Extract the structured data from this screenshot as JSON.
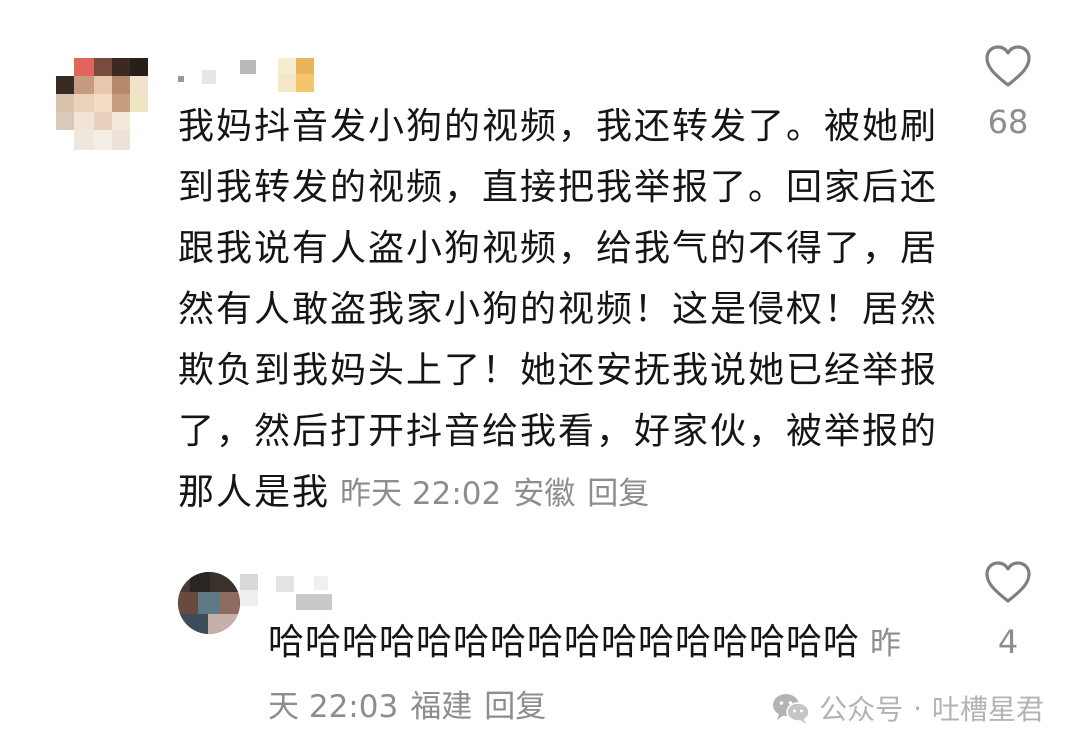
{
  "comments": [
    {
      "text": "我妈抖音发小狗的视频，我还转发了。被她刷到我转发的视频，直接把我举报了。回家后还跟我说有人盗小狗视频，给我气的不得了，居然有人敢盗我家小狗的视频！这是侵权！居然欺负到我妈头上了！她还安抚我说她已经举报了，然后打开抖音给我看，好家伙，被举报的那人是我",
      "time": "昨天 22:02",
      "location": "安徽",
      "reply_label": "回复",
      "likes": "68"
    },
    {
      "text": "哈哈哈哈哈哈哈哈哈哈哈哈哈哈哈哈",
      "time": "昨天 22:03",
      "location": "福建",
      "reply_label": "回复",
      "likes": "4"
    }
  ],
  "watermark": {
    "platform": "公众号",
    "separator": "·",
    "account": "吐槽星君"
  },
  "colors": {
    "text": "#151515",
    "meta": "#8d8d8d",
    "watermark": "#b3b3b3"
  },
  "icons": {
    "like": "heart-outline-icon",
    "watermark": "wechat-icon"
  }
}
